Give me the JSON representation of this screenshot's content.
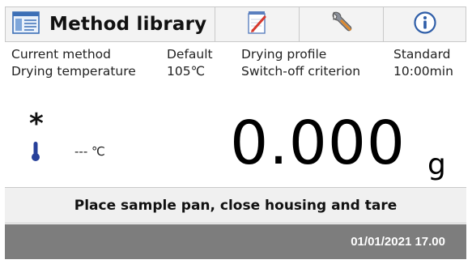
{
  "header": {
    "title": "Method library",
    "icons": {
      "title": "method-library-icon",
      "edit": "notepad-edit-icon",
      "settings": "wrench-icon",
      "info": "info-icon"
    }
  },
  "info": {
    "current_method_label": "Current method",
    "current_method_value": "Default",
    "drying_profile_label": "Drying profile",
    "drying_profile_value": "Standard",
    "drying_temperature_label": "Drying temperature",
    "drying_temperature_value": "105℃",
    "switch_off_label": "Switch-off criterion",
    "switch_off_value": "10:00min"
  },
  "measurement": {
    "stability_symbol": "*",
    "temperature_reading": "--- ℃",
    "weight_value": "0.000",
    "weight_unit": "g"
  },
  "prompt": {
    "text": "Place sample pan, close housing and tare"
  },
  "status": {
    "datetime": "01/01/2021 17.00"
  },
  "colors": {
    "status_bar": "#7d7d7d",
    "header_bg": "#f3f3f3",
    "prompt_bg": "#f0f0f0",
    "thermometer": "#27409a"
  }
}
